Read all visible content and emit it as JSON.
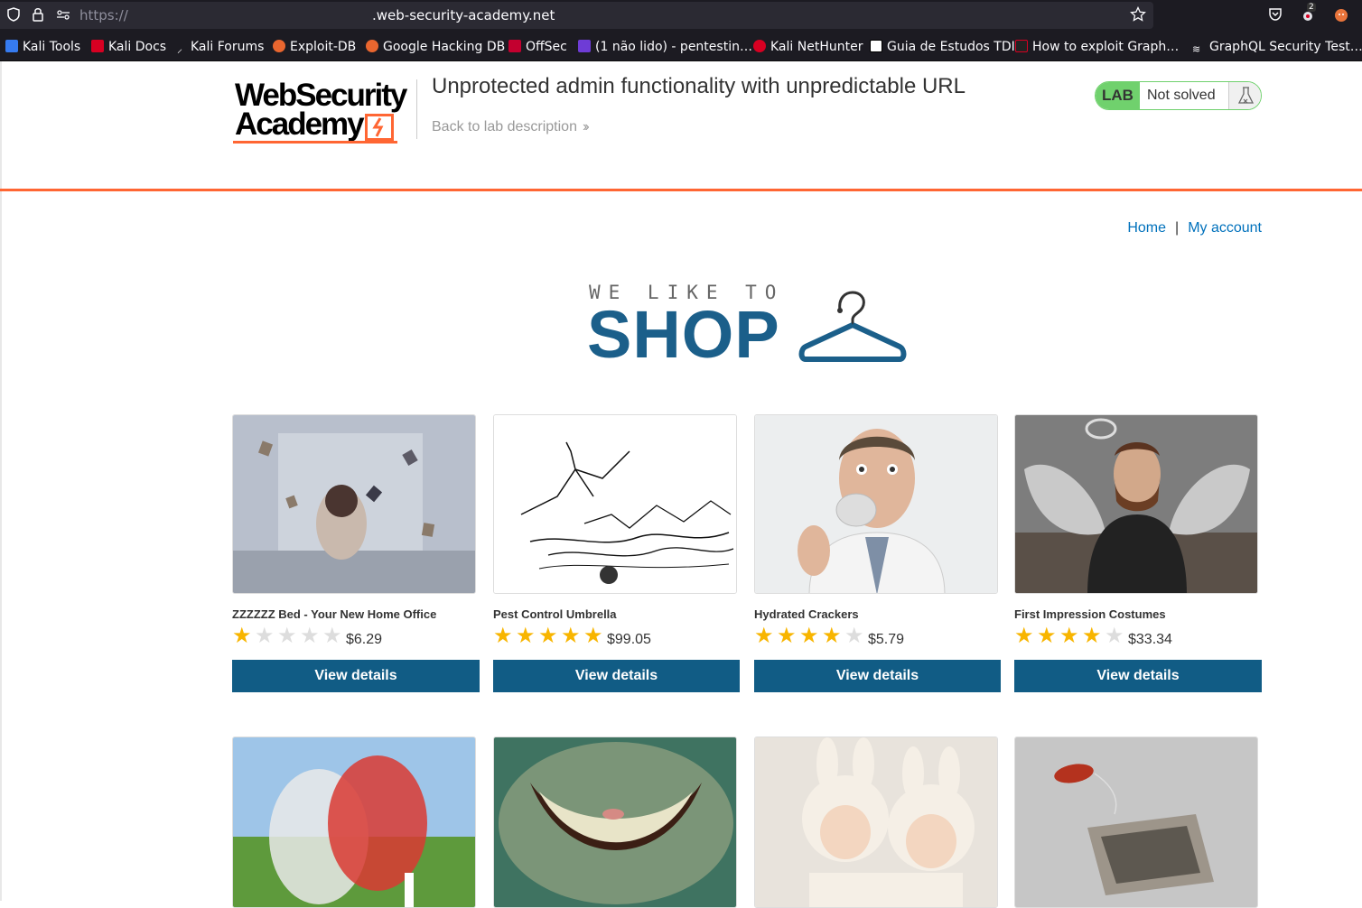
{
  "browser": {
    "url_prefix": "https://",
    "url_host": ".web-security-academy.net",
    "bookmarks": [
      {
        "label": "Kali Tools"
      },
      {
        "label": "Kali Docs"
      },
      {
        "label": "Kali Forums"
      },
      {
        "label": "Exploit-DB"
      },
      {
        "label": "Google Hacking DB"
      },
      {
        "label": "OffSec"
      },
      {
        "label": "(1 não lido) - pentestin…"
      },
      {
        "label": "Kali NetHunter"
      },
      {
        "label": "Guia de Estudos TDI"
      },
      {
        "label": "How to exploit Graph…"
      },
      {
        "label": "GraphQL Security Test…"
      }
    ],
    "extension_badge": "2"
  },
  "header": {
    "logo_line1": "WebSecurity",
    "logo_line2": "Academy",
    "lab_title": "Unprotected admin functionality with unpredictable URL",
    "back_link": "Back to lab description",
    "lab_label": "LAB",
    "lab_status": "Not solved"
  },
  "nav": {
    "home": "Home",
    "separator": "|",
    "my_account": "My account"
  },
  "shop_logo": {
    "tagline": "WE LIKE TO",
    "word": "SHOP"
  },
  "products": [
    {
      "name": "ZZZZZZ Bed - Your New Home Office",
      "rating": 1,
      "price": "$6.29",
      "button": "View details"
    },
    {
      "name": "Pest Control Umbrella",
      "rating": 5,
      "price": "$99.05",
      "button": "View details"
    },
    {
      "name": "Hydrated Crackers",
      "rating": 4,
      "price": "$5.79",
      "button": "View details"
    },
    {
      "name": "First Impression Costumes",
      "rating": 4,
      "price": "$33.34",
      "button": "View details"
    }
  ],
  "colors": {
    "accent_orange": "#ff6633",
    "button_blue": "#115c85",
    "link_blue": "#0071bc",
    "lab_green": "#70d16d",
    "star_gold": "#f8b500"
  }
}
